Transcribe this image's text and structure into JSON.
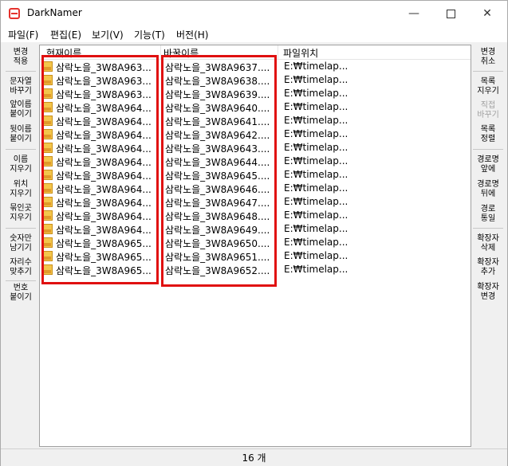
{
  "window": {
    "title": "DarkNamer",
    "minimize_glyph": "—",
    "close_glyph": "✕"
  },
  "menu": [
    "파일(F)",
    "편집(E)",
    "보기(V)",
    "기능(T)",
    "버전(H)"
  ],
  "left_buttons": [
    {
      "label": "변경\n적용",
      "enabled": true
    },
    {
      "label": "문자열\n바꾸기",
      "enabled": true
    },
    {
      "label": "앞이름\n붙이기",
      "enabled": true
    },
    {
      "label": "뒷이름\n붙이기",
      "enabled": true
    },
    {
      "label": "이름\n지우기",
      "enabled": true
    },
    {
      "label": "위치\n지우기",
      "enabled": true
    },
    {
      "label": "묶인곳\n지우기",
      "enabled": true
    },
    {
      "label": "숫자만\n남기기",
      "enabled": true
    },
    {
      "label": "자리수\n맞추기",
      "enabled": true
    },
    {
      "label": "번호\n붙이기",
      "enabled": true
    }
  ],
  "right_buttons": [
    {
      "label": "변경\n취소",
      "enabled": true
    },
    {
      "label": "목록\n지우기",
      "enabled": true
    },
    {
      "label": "직접\n바꾸기",
      "enabled": false
    },
    {
      "label": "목록\n정렬",
      "enabled": true
    },
    {
      "label": "경로명\n앞에",
      "enabled": true
    },
    {
      "label": "경로명\n뒤에",
      "enabled": true
    },
    {
      "label": "경로\n통일",
      "enabled": true
    },
    {
      "label": "확장자\n삭제",
      "enabled": true
    },
    {
      "label": "확장자\n추가",
      "enabled": true
    },
    {
      "label": "확장자\n변경",
      "enabled": true
    }
  ],
  "columns": [
    "현재이름",
    "바꿀이름",
    "파일위치"
  ],
  "rows": [
    {
      "current": "삼락노을_3W8A963...",
      "new": "삼락노을_3W8A9637....",
      "location": "E:₩timelap..."
    },
    {
      "current": "삼락노을_3W8A963...",
      "new": "삼락노을_3W8A9638....",
      "location": "E:₩timelap..."
    },
    {
      "current": "삼락노을_3W8A963...",
      "new": "삼락노을_3W8A9639....",
      "location": "E:₩timelap..."
    },
    {
      "current": "삼락노을_3W8A964...",
      "new": "삼락노을_3W8A9640....",
      "location": "E:₩timelap..."
    },
    {
      "current": "삼락노을_3W8A964...",
      "new": "삼락노을_3W8A9641....",
      "location": "E:₩timelap..."
    },
    {
      "current": "삼락노을_3W8A964...",
      "new": "삼락노을_3W8A9642....",
      "location": "E:₩timelap..."
    },
    {
      "current": "삼락노을_3W8A964...",
      "new": "삼락노을_3W8A9643....",
      "location": "E:₩timelap..."
    },
    {
      "current": "삼락노을_3W8A964...",
      "new": "삼락노을_3W8A9644....",
      "location": "E:₩timelap..."
    },
    {
      "current": "삼락노을_3W8A964...",
      "new": "삼락노을_3W8A9645....",
      "location": "E:₩timelap..."
    },
    {
      "current": "삼락노을_3W8A964...",
      "new": "삼락노을_3W8A9646....",
      "location": "E:₩timelap..."
    },
    {
      "current": "삼락노을_3W8A964...",
      "new": "삼락노을_3W8A9647....",
      "location": "E:₩timelap..."
    },
    {
      "current": "삼락노을_3W8A964...",
      "new": "삼락노을_3W8A9648....",
      "location": "E:₩timelap..."
    },
    {
      "current": "삼락노을_3W8A964...",
      "new": "삼락노을_3W8A9649....",
      "location": "E:₩timelap..."
    },
    {
      "current": "삼락노을_3W8A965...",
      "new": "삼락노을_3W8A9650....",
      "location": "E:₩timelap..."
    },
    {
      "current": "삼락노을_3W8A965...",
      "new": "삼락노을_3W8A9651....",
      "location": "E:₩timelap..."
    },
    {
      "current": "삼락노을_3W8A965...",
      "new": "삼락노을_3W8A9652....",
      "location": "E:₩timelap..."
    }
  ],
  "status": "16 개",
  "colors": {
    "highlight": "#e01010",
    "disabled_text": "#a0a0a0",
    "file_icon": "#f3c64b"
  },
  "icons": {
    "app": "darknamer-app-icon",
    "file": "jpg-file-icon"
  }
}
